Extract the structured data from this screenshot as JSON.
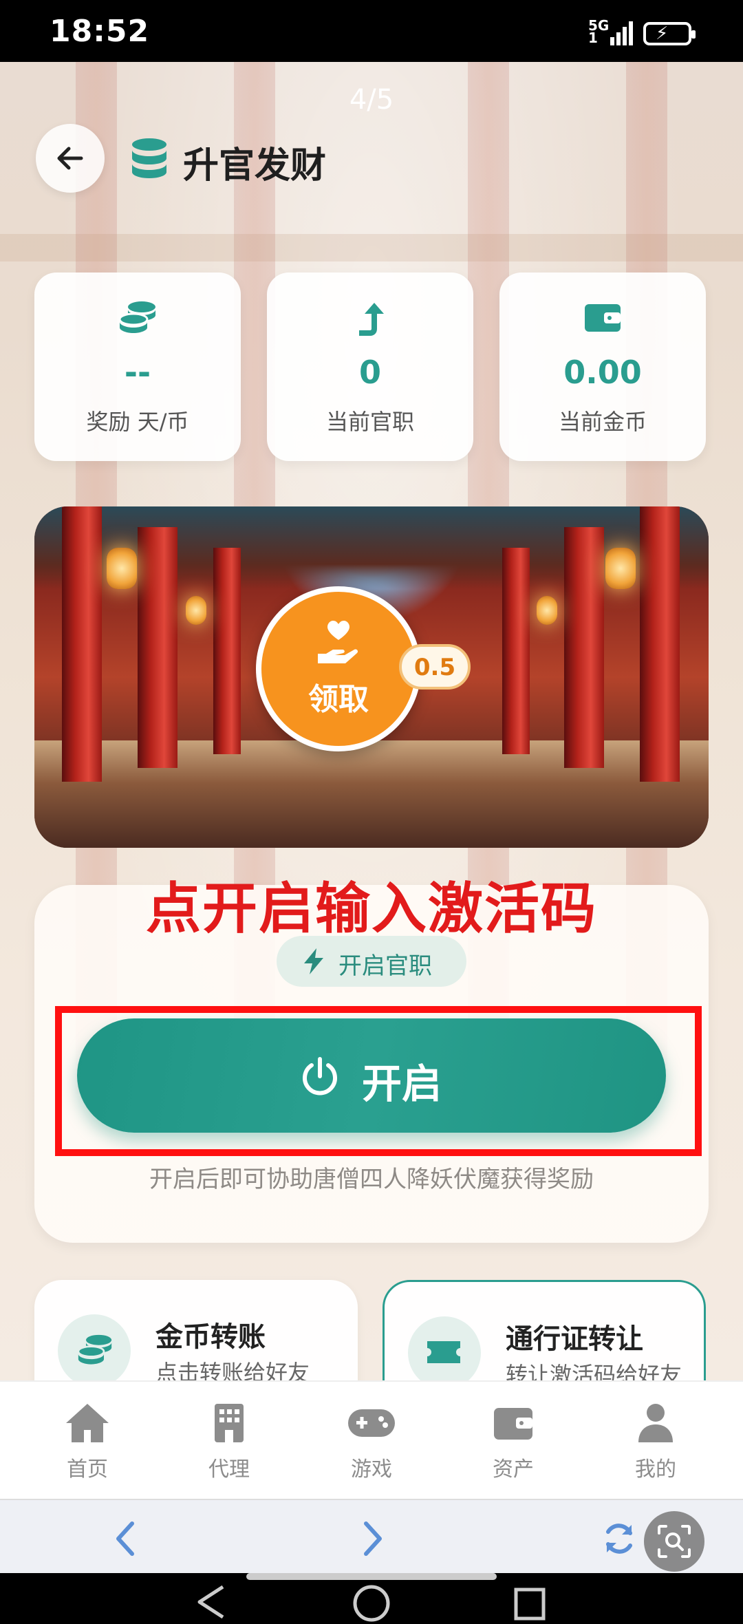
{
  "status_bar": {
    "time": "18:52",
    "network": "5G",
    "sim": "1"
  },
  "header": {
    "page_indicator": "4/5",
    "title": "升官发财"
  },
  "stats": [
    {
      "value": "--",
      "label": "奖励 天/币",
      "icon": "coins-icon"
    },
    {
      "value": "0",
      "label": "当前官职",
      "icon": "arrow-up-icon"
    },
    {
      "value": "0.00",
      "label": "当前金币",
      "icon": "wallet-icon"
    }
  ],
  "banner": {
    "claim_label": "领取",
    "claim_badge": "0.5"
  },
  "annotation": "点开启输入激活码",
  "activation": {
    "chip_label": "开启官职",
    "button_label": "开启",
    "hint": "开启后即可协助唐僧四人降妖伏魔获得奖励"
  },
  "cards": [
    {
      "title": "金币转账",
      "subtitle": "点击转账给好友"
    },
    {
      "title": "通行证转让",
      "subtitle": "转让激活码给好友"
    }
  ],
  "nav": [
    {
      "label": "首页",
      "icon": "home-icon"
    },
    {
      "label": "代理",
      "icon": "building-icon"
    },
    {
      "label": "游戏",
      "icon": "gamepad-icon"
    },
    {
      "label": "资产",
      "icon": "wallet-icon"
    },
    {
      "label": "我的",
      "icon": "user-icon"
    }
  ],
  "colors": {
    "accent": "#2a9d8f",
    "orange": "#f7931e",
    "annotation_red": "#e21b1b"
  }
}
